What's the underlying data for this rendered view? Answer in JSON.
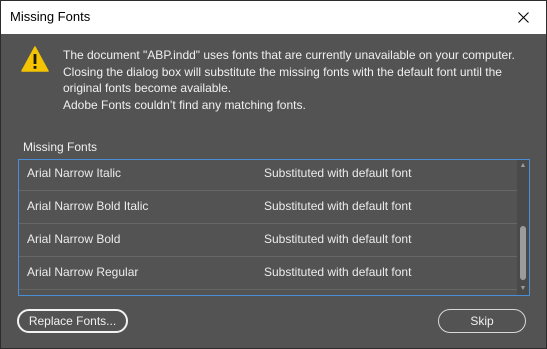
{
  "window": {
    "title": "Missing Fonts"
  },
  "message": {
    "text": "The document \"ABP.indd\" uses fonts that are currently unavailable on your computer. Closing the dialog box will substitute the missing fonts with the default font until the original fonts become available.",
    "adobe_fonts_note": "Adobe Fonts couldn’t find any matching fonts."
  },
  "list": {
    "label": "Missing Fonts",
    "rows": [
      {
        "font": "Arial Narrow Italic",
        "status": "Substituted with default font"
      },
      {
        "font": "Arial Narrow Bold Italic",
        "status": "Substituted with default font"
      },
      {
        "font": "Arial Narrow Bold",
        "status": "Substituted with default font"
      },
      {
        "font": "Arial Narrow Regular",
        "status": "Substituted with default font"
      }
    ]
  },
  "buttons": {
    "replace_fonts": "Replace Fonts...",
    "skip": "Skip"
  },
  "colors": {
    "dialog_bg": "#535353",
    "list_border": "#4a8fd6",
    "warning_yellow": "#f5c400"
  },
  "icons": {
    "close": "close-icon",
    "warning": "warning-icon",
    "scroll_up": "scroll-up-arrow-icon",
    "scroll_down": "scroll-down-arrow-icon"
  }
}
